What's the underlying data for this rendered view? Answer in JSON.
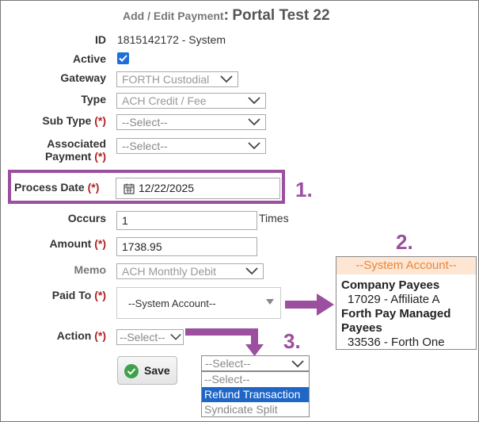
{
  "header": {
    "prefix": "Add / Edit Payment",
    "colon": ":",
    "title": "Portal Test 22"
  },
  "labels": {
    "id": "ID",
    "active": "Active",
    "gateway": "Gateway",
    "type": "Type",
    "sub_type": "Sub Type",
    "associated_1": "Associated",
    "associated_2": "Payment",
    "process_date": "Process Date",
    "occurs": "Occurs",
    "amount": "Amount",
    "memo": "Memo",
    "paid_to": "Paid To",
    "action": "Action",
    "required": "(*)"
  },
  "values": {
    "id": "1815142172 - System",
    "active_checked": true,
    "gateway": "FORTH Custodial",
    "type": "ACH Credit / Fee",
    "sub_type": "--Select--",
    "associated_payment": "--Select--",
    "process_date": "12/22/2025",
    "occurs": "1",
    "occurs_suffix": "Times",
    "amount": "1738.95",
    "memo": "ACH Monthly Debit",
    "paid_to": "--System Account--",
    "action": "--Select--"
  },
  "paid_to_popover": {
    "header": "--System Account--",
    "groups": [
      {
        "label": "Company Payees",
        "item": "17029 - Affiliate A"
      },
      {
        "label": "Forth Pay Managed Payees",
        "item": "33536 - Forth One"
      }
    ]
  },
  "action_dropdown": {
    "value": "--Select--",
    "options": [
      "--Select--",
      "Refund Transaction",
      "Syndicate Split"
    ],
    "highlighted_index": 1
  },
  "buttons": {
    "save": "Save"
  },
  "annotations": {
    "step1": "1.",
    "step2": "2.",
    "step3": "3."
  },
  "colors": {
    "annotation": "#9b4f9e",
    "required": "#b22222",
    "checkbox": "#1e6fd9",
    "highlight_option": "#1f66c7"
  }
}
